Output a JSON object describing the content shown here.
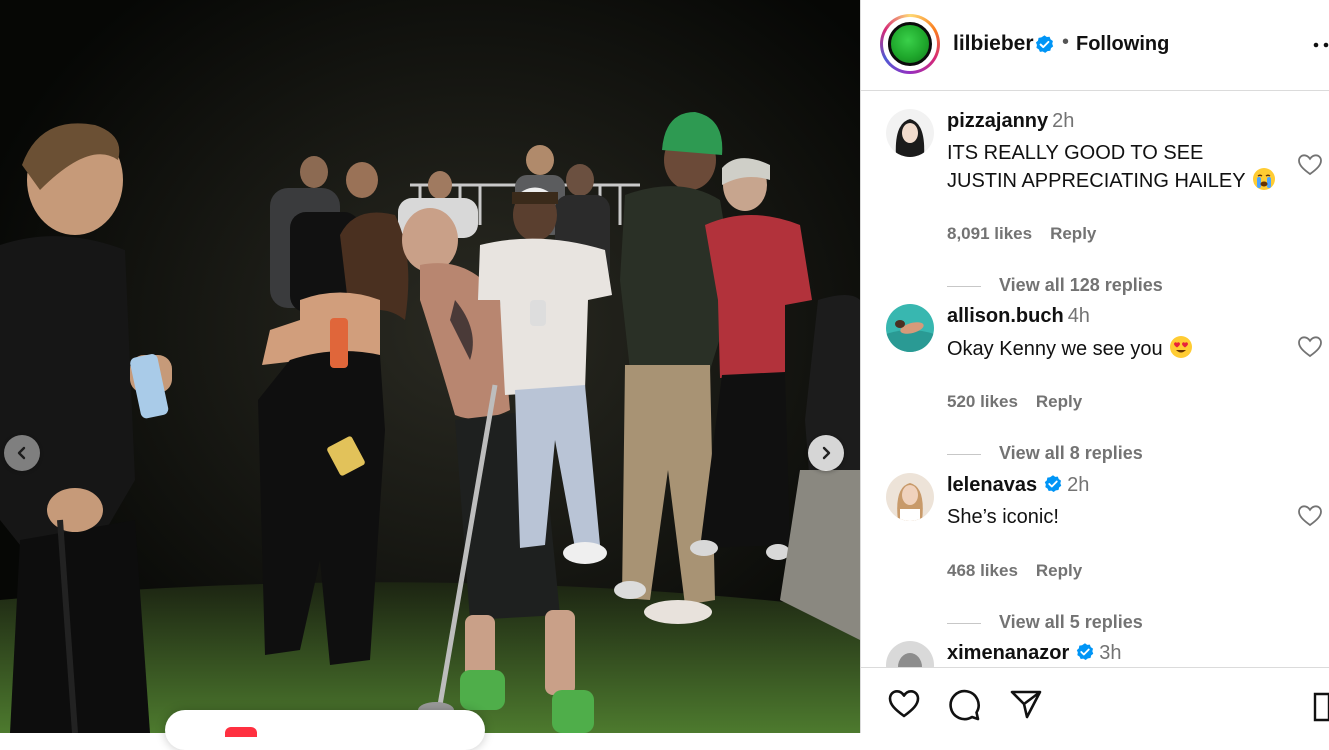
{
  "post": {
    "owner_username": "lilbieber",
    "dot": "•",
    "follow_status": "Following",
    "colors": {
      "verified": "#0095f6",
      "avatar": "#1fa82c"
    }
  },
  "carousel": {
    "prev_icon": "chevron-left-icon",
    "next_icon": "chevron-right-icon"
  },
  "comments": [
    {
      "username": "pizzajanny",
      "verified": false,
      "time": "2h",
      "text": "ITS REALLY GOOD TO SEE JUSTIN APPRECIATING HAILEY",
      "emoji": "crying-face-emoji",
      "likes": "8,091 likes",
      "reply": "Reply",
      "view_replies": "View all 128 replies"
    },
    {
      "username": "allison.buch",
      "verified": false,
      "time": "4h",
      "text": "Okay Kenny we see you",
      "emoji": "heart-eyes-emoji",
      "likes": "520 likes",
      "reply": "Reply",
      "view_replies": "View all 8 replies"
    },
    {
      "username": "lelenavas",
      "verified": true,
      "time": "2h",
      "text": "She’s iconic!",
      "emoji": "",
      "likes": "468 likes",
      "reply": "Reply",
      "view_replies": "View all 5 replies"
    },
    {
      "username": "ximenanazor",
      "verified": true,
      "time": "3h"
    }
  ],
  "actions": {
    "like_icon": "heart-icon",
    "comment_icon": "comment-icon",
    "share_icon": "share-icon",
    "save_icon": "bookmark-icon"
  }
}
